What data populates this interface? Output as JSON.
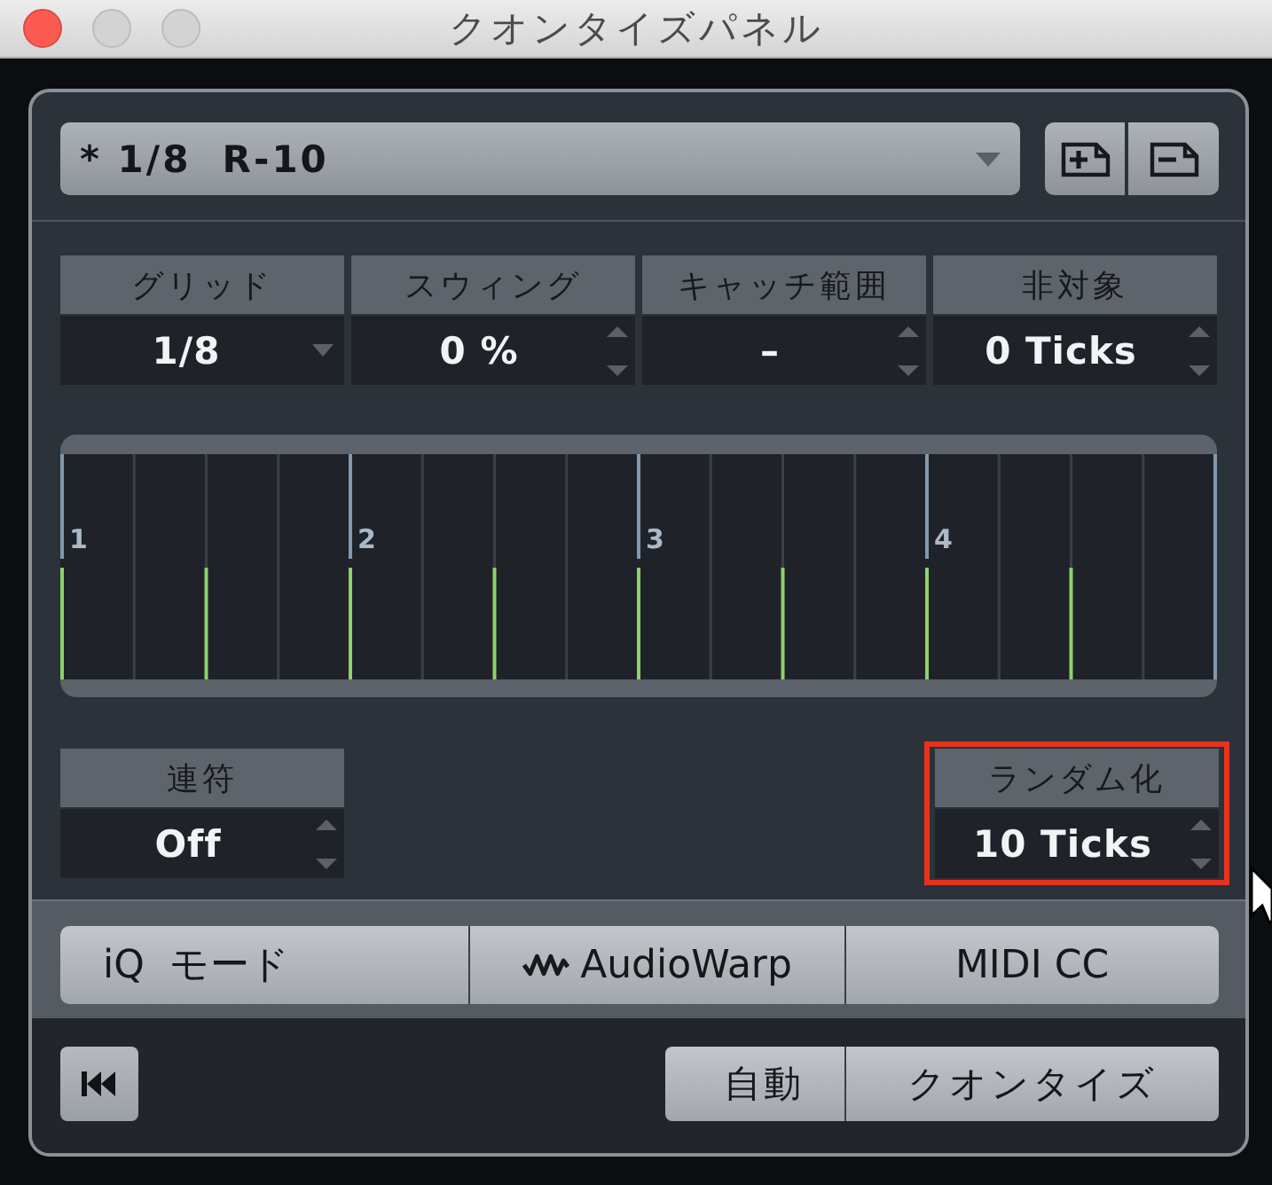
{
  "window": {
    "title": "クオンタイズパネル"
  },
  "preset": {
    "value": "* 1/8  R-10"
  },
  "parameters": [
    {
      "label": "グリッド",
      "value": "1/8",
      "kind": "dropdown"
    },
    {
      "label": "スウィング",
      "value": "0 %",
      "kind": "spinner"
    },
    {
      "label": "キャッチ範囲",
      "value": "–",
      "kind": "spinner"
    },
    {
      "label": "非対象",
      "value": "0 Ticks",
      "kind": "spinner"
    }
  ],
  "grid_display": {
    "beat_labels": [
      "1",
      "2",
      "3",
      "4"
    ]
  },
  "lower_parameters": [
    {
      "label": "連符",
      "value": "Off",
      "kind": "spinner",
      "highlighted": false
    },
    {
      "label": "ランダム化",
      "value": "10 Ticks",
      "kind": "spinner",
      "highlighted": true
    }
  ],
  "mode_buttons": [
    {
      "label": "iQ  モード",
      "kind": "plain"
    },
    {
      "label": "AudioWarp",
      "kind": "wave"
    },
    {
      "label": "MIDI CC",
      "kind": "plain"
    }
  ],
  "action_buttons": [
    {
      "label": "自動"
    },
    {
      "label": "クオンタイズ"
    }
  ]
}
